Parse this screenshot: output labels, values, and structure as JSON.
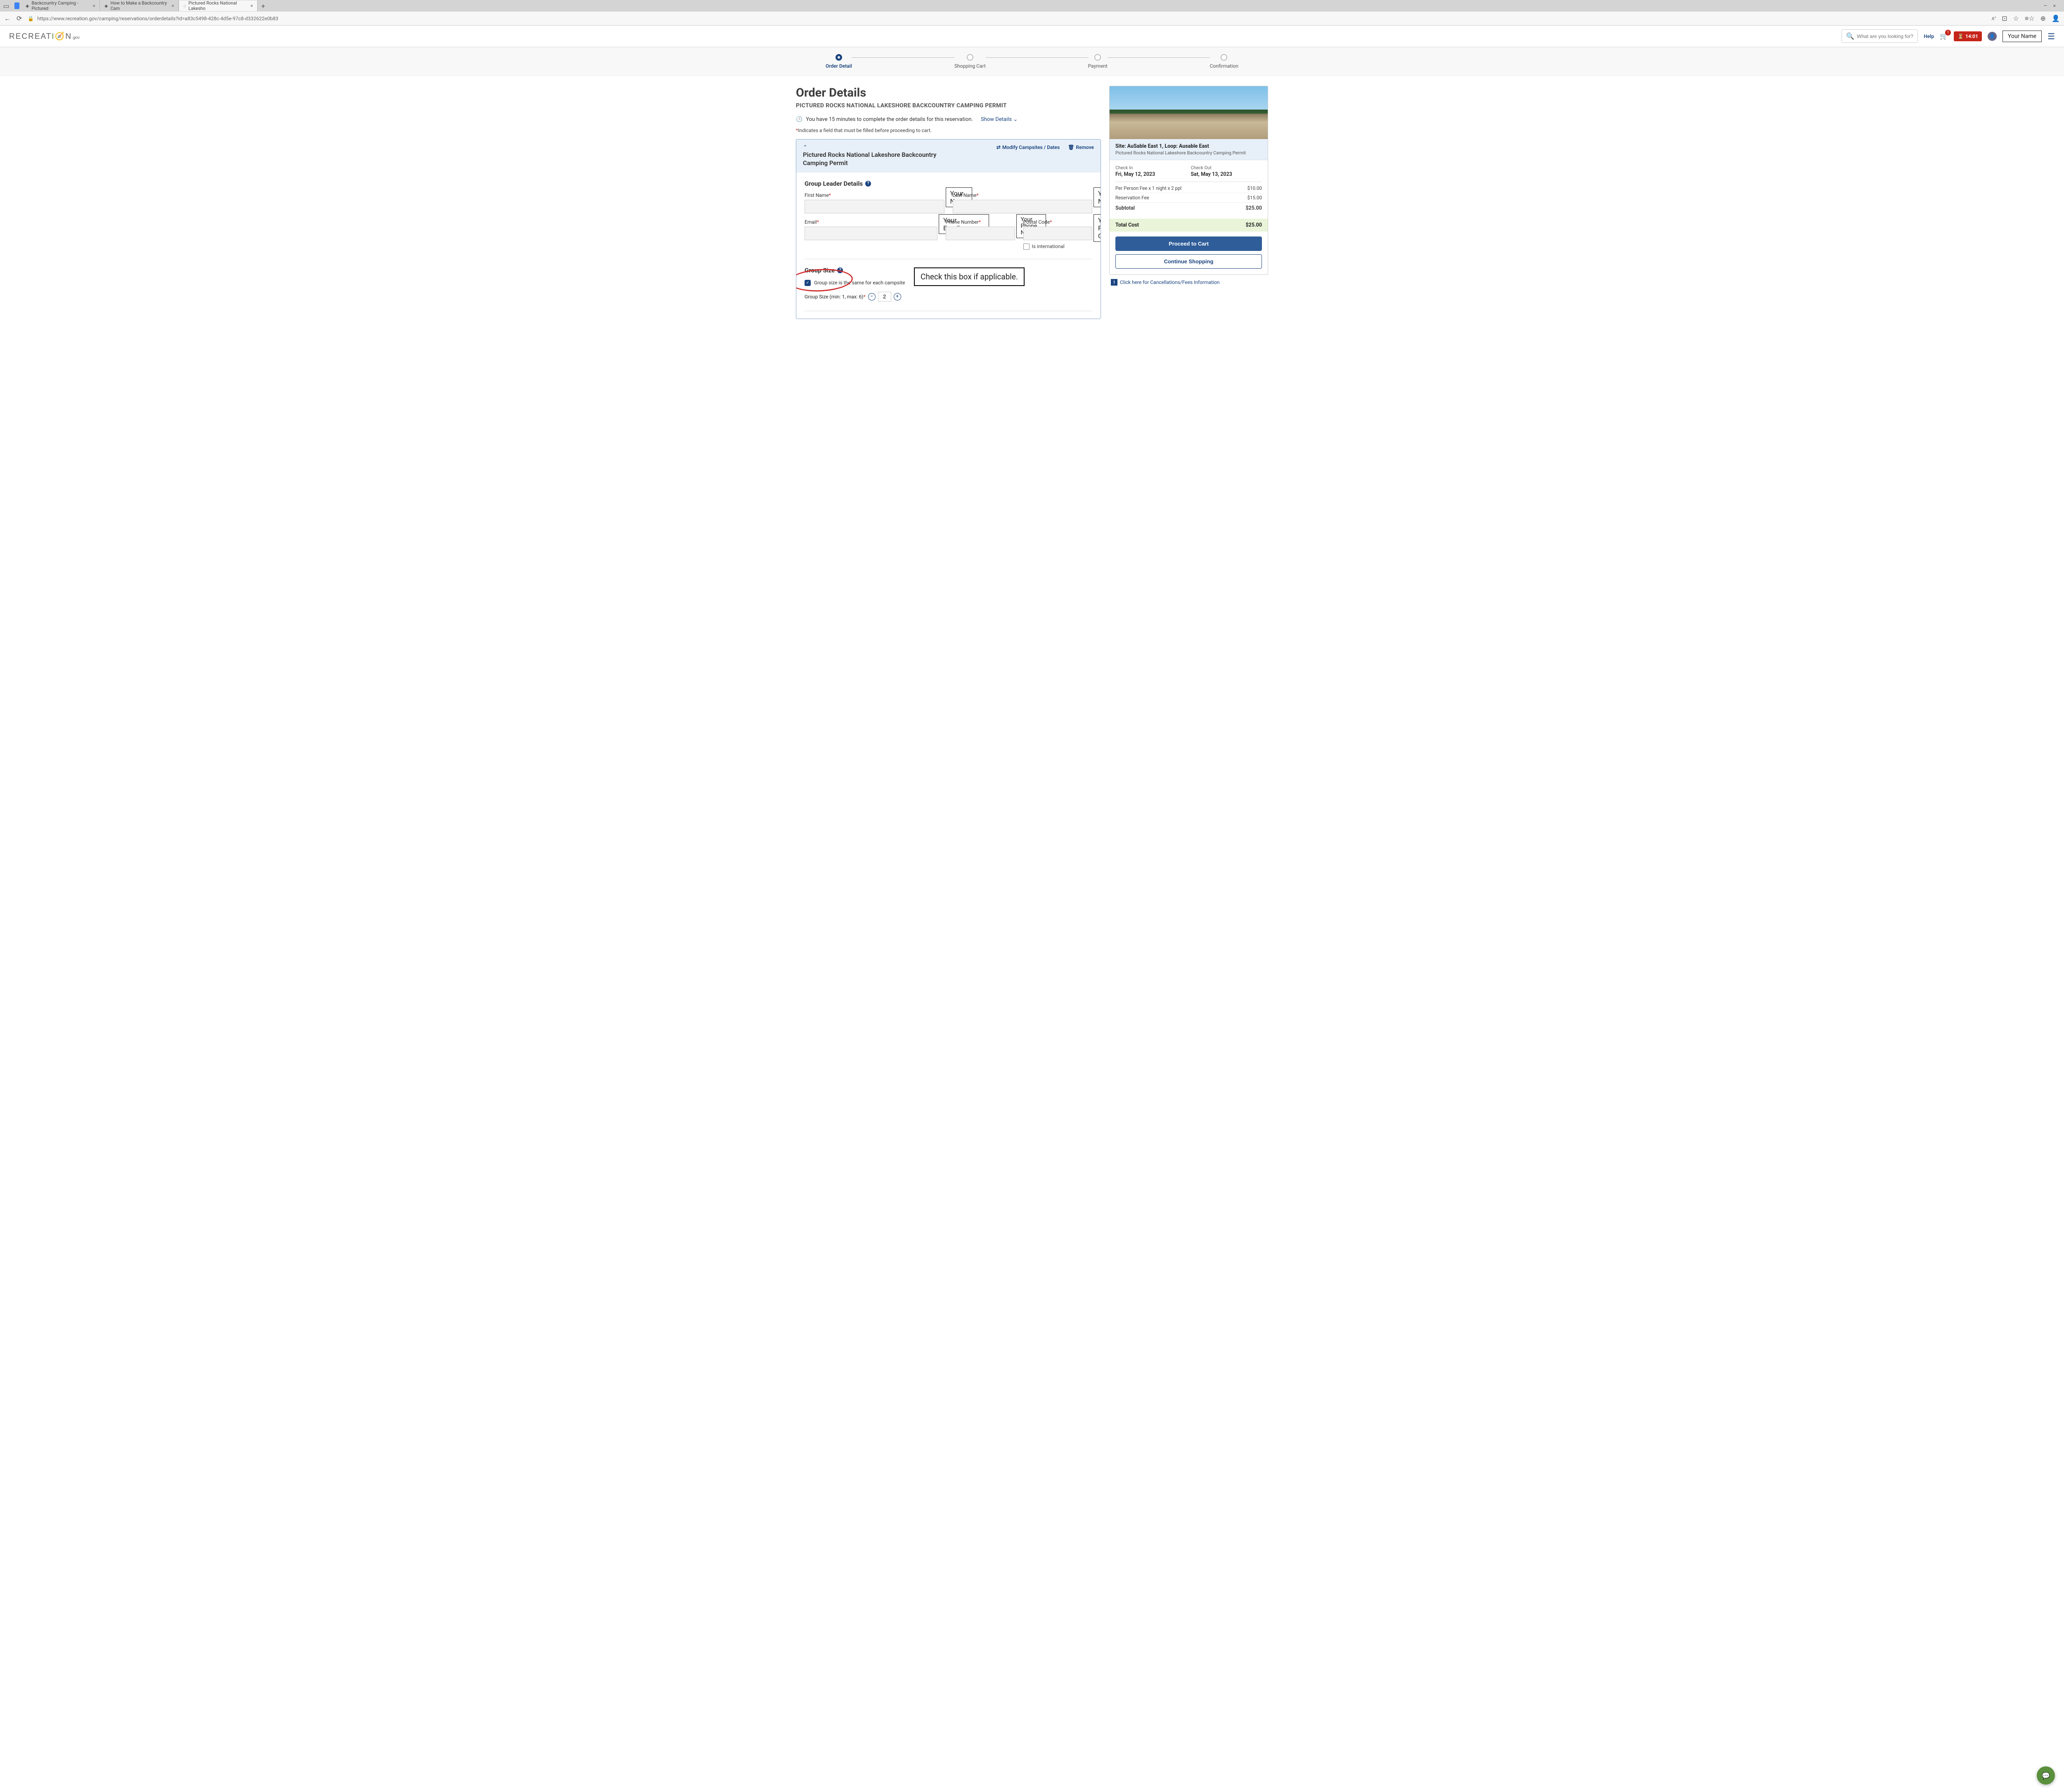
{
  "browser": {
    "tabs": [
      {
        "label": "Backcountry Camping - Pictured"
      },
      {
        "label": "How to Make a Backcountry Cam"
      },
      {
        "label": "Pictured Rocks National Lakesho"
      }
    ],
    "url": "https://www.recreation.gov/camping/reservations/orderdetails?id=a83c5498-428c-4d5e-97c8-d332622e0b83",
    "window_controls": {
      "min": "—",
      "close": "×"
    }
  },
  "header": {
    "logo": "RECREATI🧭N",
    "logo_suffix": ".gov",
    "search_placeholder": "What are you looking for?",
    "help": "Help",
    "cart_count": "1",
    "timer": "14:01",
    "user_name": "Your Name"
  },
  "stepper": {
    "steps": [
      "Order Detail",
      "Shopping Cart",
      "Payment",
      "Confirmation"
    ]
  },
  "page": {
    "title": "Order Details",
    "subtitle": "PICTURED ROCKS NATIONAL LAKESHORE BACKCOUNTRY CAMPING PERMIT",
    "info_msg": "You have 15 minutes to complete the order details for this reservation.",
    "show_details": "Show Details",
    "req_note": "Indicates a field that must be filled before proceeding to cart."
  },
  "card": {
    "name": "Pictured Rocks National Lakeshore Backcountry Camping Permit",
    "modify": "Modify Campsites / Dates",
    "remove": "Remove"
  },
  "leader": {
    "title": "Group Leader Details",
    "first_name_label": "First Name",
    "first_name_value": "Your Name",
    "last_name_label": "Last Name",
    "last_name_value": "Your Name",
    "email_label": "Email",
    "email_value": "Your Email",
    "phone_label": "Phone Number",
    "phone_value": "Your Phone Number",
    "postal_label": "Postal Code",
    "postal_value": "Your Postal Code",
    "intl_label": "Is international"
  },
  "group": {
    "title": "Group Size",
    "checkbox_label": "Group size is the same for each campsite",
    "size_label": "Group Size (min: 1, max: 6)",
    "size_value": "2",
    "annotation": "Check this box if applicable."
  },
  "summary": {
    "site_name": "Site: AuSable East 1, Loop: Ausable East",
    "site_sub": "Pictured Rocks National Lakeshore Backcountry Camping Permit",
    "checkin_label": "Check In",
    "checkin_value": "Fri, May 12, 2023",
    "checkout_label": "Check Out",
    "checkout_value": "Sat, May 13, 2023",
    "fee1_label": "Per Person Fee x 1 night x 2 ppl",
    "fee1_value": "$10.00",
    "fee2_label": "Reservation Fee",
    "fee2_value": "$15.00",
    "subtotal_label": "Subtotal",
    "subtotal_value": "$25.00",
    "total_label": "Total Cost",
    "total_value": "$25.00",
    "proceed": "Proceed to Cart",
    "continue": "Continue Shopping",
    "cancel_link": "Click here for Cancellations/Fees Information"
  }
}
